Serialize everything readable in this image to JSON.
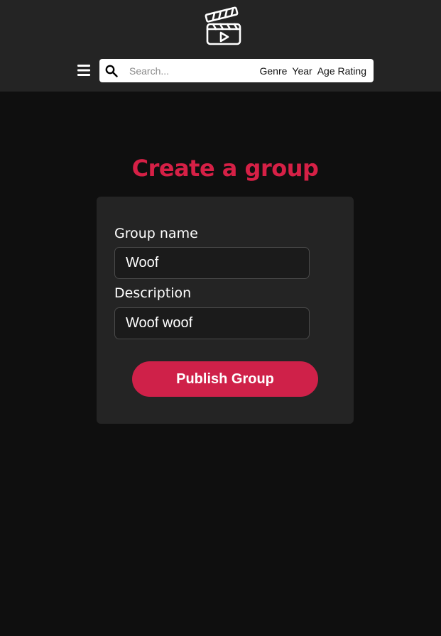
{
  "header": {
    "logo_icon": "clapperboard-play-icon",
    "menu_icon": "hamburger-menu-icon",
    "search": {
      "icon": "search-icon",
      "placeholder": "Search...",
      "value": ""
    },
    "filters": [
      "Genre",
      "Year",
      "Age Rating"
    ]
  },
  "main": {
    "title": "Create a group",
    "form": {
      "group_name_label": "Group name",
      "group_name_value": "Woof",
      "description_label": "Description",
      "description_value": "Woof woof",
      "submit_label": "Publish Group"
    }
  },
  "colors": {
    "accent": "#d62046",
    "header_bg": "#242424",
    "page_bg": "#0f0f0f",
    "card_bg": "#242424"
  }
}
